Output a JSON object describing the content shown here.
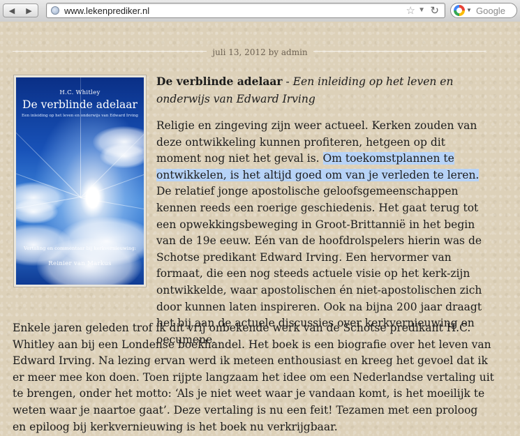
{
  "browser": {
    "url": "www.lekenprediker.nl",
    "search_placeholder": "Google",
    "back_icon": "back-arrow-icon",
    "forward_icon": "forward-arrow-icon"
  },
  "post": {
    "date": "juli 13, 2012",
    "by": "by",
    "author": "admin",
    "title": "De verblinde adelaar",
    "title_sep": " - ",
    "subtitle": "Een inleiding op het leven en onderwijs van Edward Irving",
    "para1_before": "Religie en zingeving zijn weer actueel. Kerken zouden van deze ontwikkeling kunnen profiteren, hetgeen op dit moment nog niet het geval is. ",
    "para1_highlight": "Om toekomstplannen te ontwikkelen, is het altijd goed om van je verleden te leren.",
    "para1_after": " De relatief jonge apostolische geloofsgemeenschappen kennen reeds een roerige geschiedenis. Het gaat terug tot een opwekkingsbeweging in Groot-Brittannië in het begin van de 19e eeuw. Eén van de hoofdrolspelers hierin was de Schotse predikant Edward Irving. Een hervormer van formaat, die een nog steeds actuele visie op het kerk-zijn ontwikkelde, waar apostolischen én niet-apostolischen zich door kunnen laten inspireren. Ook na bijna 200 jaar draagt het bij aan de actuele discussies over kerkvernieuwing en oecumene.",
    "para2": "Enkele jaren geleden trof ik dit vrij onbekende werk van de Schotse predikant H.C. Whitley aan bij een Londense boekhandel. Het boek is een biografie over het leven van Edward Irving. Na lezing ervan werd ik meteen enthousiast en kreeg het gevoel dat ik er meer mee kon doen. Toen rijpte langzaam het idee om een Nederlandse vertaling uit te brengen, onder het motto: ‘Als je niet weet waar je vandaan komt, is het moeilijk te weten waar je naartoe gaat’. Deze vertaling is nu een feit! Tezamen met een proloog en epiloog bij kerkvernieuwing is het boek nu verkrijgbaar."
  },
  "cover": {
    "author": "H.C. Whitley",
    "title": "De verblinde adelaar",
    "subtitle": "Een inleiding op het leven en onderwijs van Edward Irving",
    "translation_note": "Vertaling en commentaar bij kerkvernieuwing:",
    "translator": "Reinier van Markus"
  }
}
